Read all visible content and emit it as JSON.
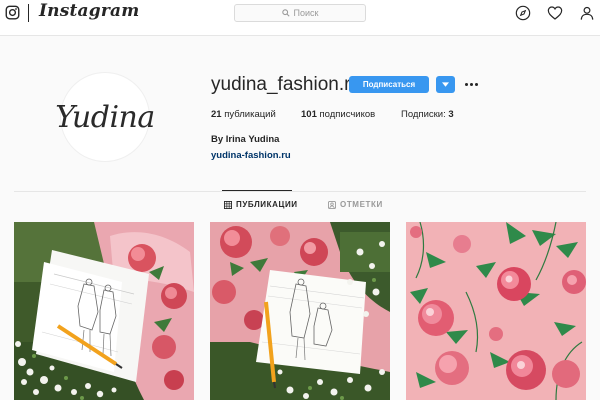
{
  "topbar": {
    "logo_icon": "instagram-camera-icon",
    "wordmark": "Instagram",
    "search": {
      "icon": "search-icon",
      "placeholder": "Поиск"
    },
    "icons": [
      "explore-compass-icon",
      "heart-icon",
      "user-icon"
    ]
  },
  "profile": {
    "avatar_text": "Yudina",
    "username": "yudina_fashion.ru",
    "follow_label": "Подписаться",
    "dropdown_icon": "chevron-down-icon",
    "more_icon": "more-options-icon",
    "stats": {
      "posts": {
        "count": "21",
        "label": "публикаций"
      },
      "followers": {
        "count": "101",
        "label": "подписчиков"
      },
      "following": {
        "label": "Подписки:",
        "count": "3"
      }
    },
    "full_name": "By Irina Yudina",
    "website": "yudina-fashion.ru"
  },
  "tabs": [
    {
      "label": "ПУБЛИКАЦИИ",
      "icon": "grid-icon",
      "active": true
    },
    {
      "label": "ОТМЕТКИ",
      "icon": "tag-icon",
      "active": false
    }
  ],
  "colors": {
    "primary_button": "#3897f0",
    "link": "#003569",
    "tile_pink": "#f2b2b6"
  },
  "posts": [
    {
      "icon": "fashion-sketch-photo"
    },
    {
      "icon": "fashion-sketch-photo"
    },
    {
      "icon": "peony-print-photo"
    }
  ]
}
